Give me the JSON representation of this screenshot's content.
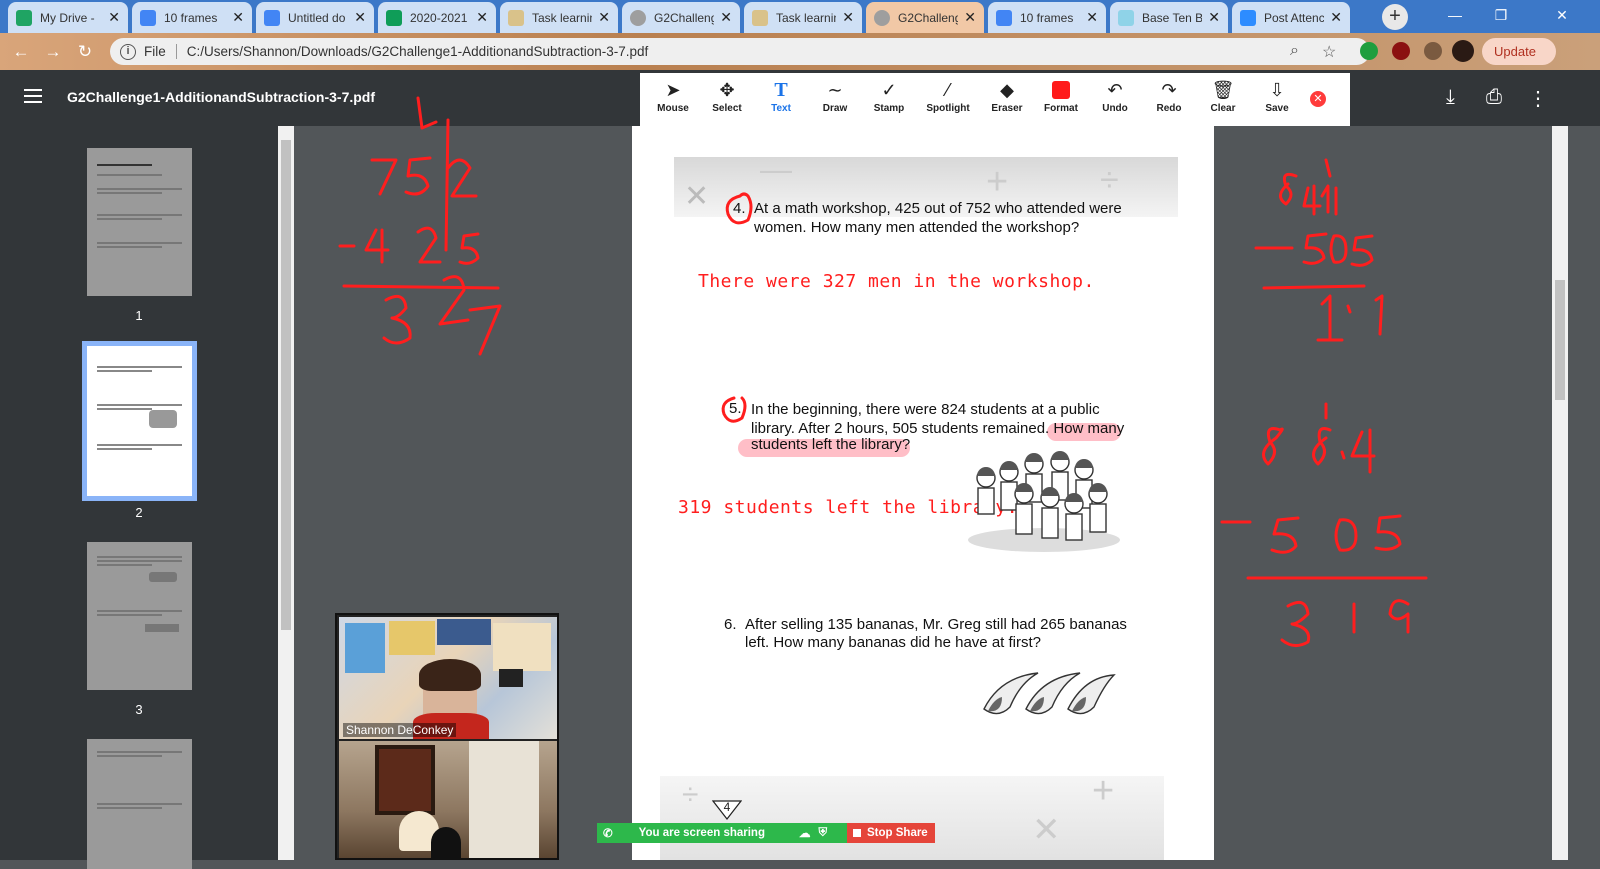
{
  "browser": {
    "tabs": [
      {
        "label": "My Drive - ",
        "icon_color": "#1fa463",
        "active": false
      },
      {
        "label": "10 frames",
        "icon_color": "#4285f4",
        "active": false
      },
      {
        "label": "Untitled do",
        "icon_color": "#4285f4",
        "active": false
      },
      {
        "label": "2020-2021",
        "icon_color": "#0f9d58",
        "active": false
      },
      {
        "label": "Task learnin",
        "icon_color": "#d9c28a",
        "active": false
      },
      {
        "label": "G2Challeng",
        "icon_color": "#9e9e9e",
        "active": false
      },
      {
        "label": "Task learnin",
        "icon_color": "#d9c28a",
        "active": false
      },
      {
        "label": "G2Challeng",
        "icon_color": "#9e9e9e",
        "active": true
      },
      {
        "label": "10 frames",
        "icon_color": "#4285f4",
        "active": false
      },
      {
        "label": "Base Ten Bl",
        "icon_color": "#8fd3e8",
        "active": false
      },
      {
        "label": "Post Attenc",
        "icon_color": "#2d8cff",
        "active": false
      }
    ],
    "address": {
      "scheme": "File",
      "url": "C:/Users/Shannon/Downloads/G2Challenge1-AdditionandSubtraction-3-7.pdf"
    },
    "update_label": "Update"
  },
  "pdf": {
    "title": "G2Challenge1-AdditionandSubtraction-3-7.pdf",
    "tools": [
      {
        "label": "Mouse",
        "icon": "cursor-icon"
      },
      {
        "label": "Select",
        "icon": "move-icon"
      },
      {
        "label": "Text",
        "icon": "text-icon",
        "active": true
      },
      {
        "label": "Draw",
        "icon": "draw-icon"
      },
      {
        "label": "Stamp",
        "icon": "check-icon"
      },
      {
        "label": "Spotlight",
        "icon": "wand-icon"
      },
      {
        "label": "Eraser",
        "icon": "eraser-icon"
      },
      {
        "label": "Format",
        "icon": "color-swatch-icon"
      },
      {
        "label": "Undo",
        "icon": "undo-icon"
      },
      {
        "label": "Redo",
        "icon": "redo-icon"
      },
      {
        "label": "Clear",
        "icon": "trash-icon"
      },
      {
        "label": "Save",
        "icon": "save-icon"
      }
    ],
    "thumbnails": [
      "1",
      "2",
      "3"
    ],
    "page_number": "4"
  },
  "questions": {
    "q4_num": "4.",
    "q4_line1": "At a math workshop, 425 out of 752 who attended were",
    "q4_line2": "women. How many men attended the workshop?",
    "q4_answer": "There were 327 men in the workshop.",
    "q5_num": "5.",
    "q5_line1": "In the beginning, there were 824 students at a public",
    "q5_line2": "library. After 2 hours, 505 students remained. How many",
    "q5_line3": "students left the library?",
    "q5_answer": "319 students left the library.",
    "q6_num": "6.",
    "q6_line1": "After selling 135 bananas, Mr. Greg still had 265 bananas",
    "q6_line2": "left. How many bananas did he have at first?"
  },
  "video": {
    "participant_name": "Shannon DeConkey"
  },
  "share": {
    "status": "You are screen sharing",
    "stop_label": "Stop Share"
  },
  "colors": {
    "ink": "#ff1e1e",
    "accent": "#1a73e8"
  }
}
